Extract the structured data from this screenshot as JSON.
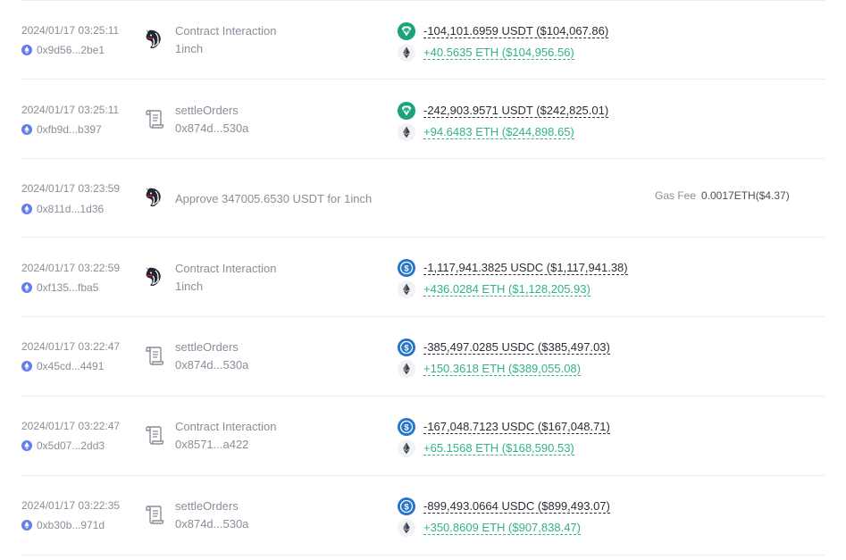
{
  "colors": {
    "negative": "#2b2e36",
    "positive": "#33b381",
    "muted": "#8a8e99",
    "usdt": "#1ba27a",
    "usdc": "#2775ca",
    "eth_badge": "#627eea"
  },
  "transactions": [
    {
      "time": "2024/01/17 03:25:11",
      "hash": "0x9d56...2be1",
      "icon": "oneinch-unicorn-icon",
      "title": "Contract Interaction",
      "subtitle": "1inch",
      "changes": [
        {
          "token": "usdt-icon",
          "text": "-104,101.6959 USDT ($104,067.86)",
          "direction": "neg"
        },
        {
          "token": "eth-icon",
          "text": "+40.5635 ETH ($104,956.56)",
          "direction": "pos"
        }
      ]
    },
    {
      "time": "2024/01/17 03:25:11",
      "hash": "0xfb9d...b397",
      "icon": "contract-scroll-icon",
      "title": "settleOrders",
      "subtitle": "0x874d...530a",
      "changes": [
        {
          "token": "usdt-icon",
          "text": "-242,903.9571 USDT ($242,825.01)",
          "direction": "neg"
        },
        {
          "token": "eth-icon",
          "text": "+94.6483 ETH ($244,898.65)",
          "direction": "pos"
        }
      ]
    },
    {
      "time": "2024/01/17 03:23:59",
      "hash": "0x811d...1d36",
      "icon": "oneinch-unicorn-icon",
      "title": "Approve 347005.6530 USDT for 1inch",
      "gas_label": "Gas Fee",
      "gas_value": "0.0017ETH($4.37)"
    },
    {
      "time": "2024/01/17 03:22:59",
      "hash": "0xf135...fba5",
      "icon": "oneinch-unicorn-icon",
      "title": "Contract Interaction",
      "subtitle": "1inch",
      "changes": [
        {
          "token": "usdc-icon",
          "text": "-1,117,941.3825 USDC ($1,117,941.38)",
          "direction": "neg"
        },
        {
          "token": "eth-icon",
          "text": "+436.0284 ETH ($1,128,205.93)",
          "direction": "pos"
        }
      ]
    },
    {
      "time": "2024/01/17 03:22:47",
      "hash": "0x45cd...4491",
      "icon": "contract-scroll-icon",
      "title": "settleOrders",
      "subtitle": "0x874d...530a",
      "changes": [
        {
          "token": "usdc-icon",
          "text": "-385,497.0285 USDC ($385,497.03)",
          "direction": "neg"
        },
        {
          "token": "eth-icon",
          "text": "+150.3618 ETH ($389,055.08)",
          "direction": "pos"
        }
      ]
    },
    {
      "time": "2024/01/17 03:22:47",
      "hash": "0x5d07...2dd3",
      "icon": "contract-scroll-icon",
      "title": "Contract Interaction",
      "subtitle": "0x8571...a422",
      "changes": [
        {
          "token": "usdc-icon",
          "text": "-167,048.7123 USDC ($167,048.71)",
          "direction": "neg"
        },
        {
          "token": "eth-icon",
          "text": "+65.1568 ETH ($168,590.53)",
          "direction": "pos"
        }
      ]
    },
    {
      "time": "2024/01/17 03:22:35",
      "hash": "0xb30b...971d",
      "icon": "contract-scroll-icon",
      "title": "settleOrders",
      "subtitle": "0x874d...530a",
      "changes": [
        {
          "token": "usdc-icon",
          "text": "-899,493.0664 USDC ($899,493.07)",
          "direction": "neg"
        },
        {
          "token": "eth-icon",
          "text": "+350.8609 ETH ($907,838.47)",
          "direction": "pos"
        }
      ]
    }
  ]
}
